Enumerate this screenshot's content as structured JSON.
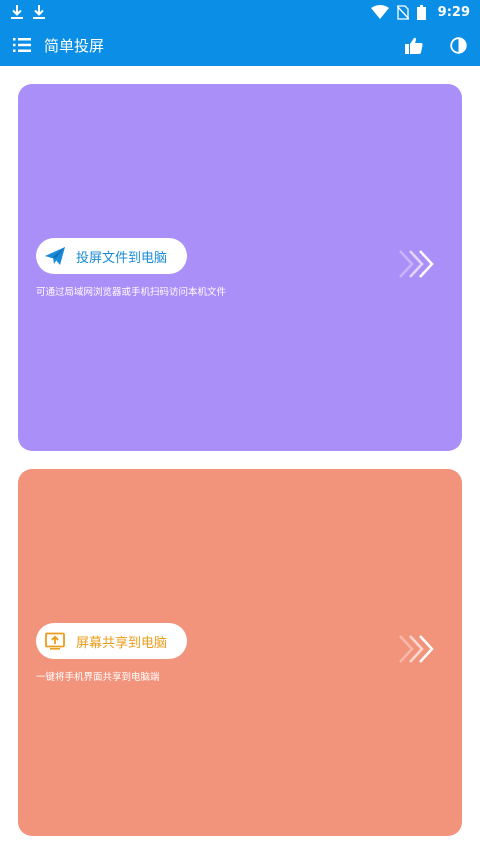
{
  "status_bar": {
    "time": "9:29",
    "left_icons": [
      "download-icon",
      "download-icon"
    ],
    "right_icons": [
      "wifi-icon",
      "no-sim-icon",
      "battery-icon"
    ]
  },
  "app_bar": {
    "title": "简单投屏",
    "color": "#0a8ee6",
    "icons": [
      "menu-icon",
      "thumbs-up-icon",
      "pie-chart-icon"
    ]
  },
  "cards": [
    {
      "label": "投屏文件到电脑",
      "description": "可通过局域网浏览器或手机扫码访问本机文件",
      "icon": "paper-plane-icon",
      "background": "#ab8ff8",
      "label_color": "#1a8ad8"
    },
    {
      "label": "屏幕共享到电脑",
      "description": "一键将手机界面共享到电脑端",
      "icon": "screen-upload-icon",
      "background": "#f2937c",
      "label_color": "#eb9c1a"
    }
  ]
}
